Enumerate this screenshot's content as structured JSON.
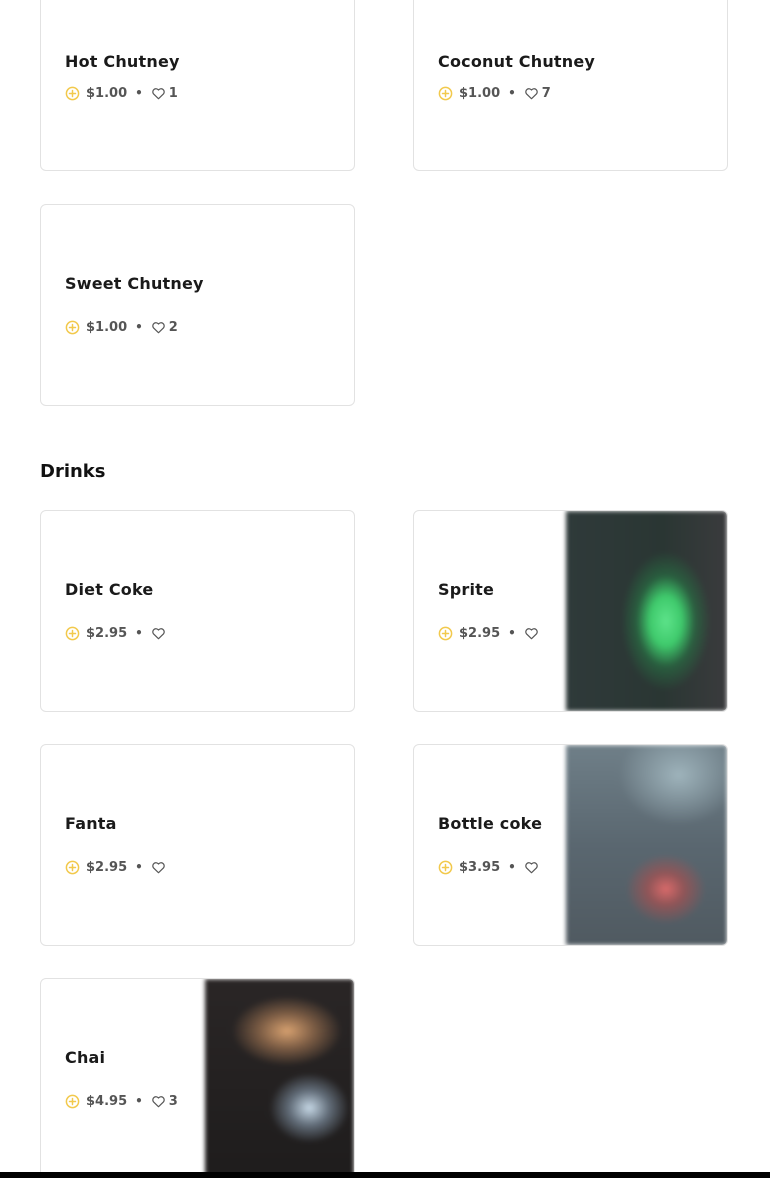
{
  "sections": {
    "drinks_title": "Drinks"
  },
  "items": {
    "hot_chutney": {
      "name": "Hot Chutney",
      "price": "$1.00",
      "likes": "1"
    },
    "coconut_chutney": {
      "name": "Coconut Chutney",
      "price": "$1.00",
      "likes": "7"
    },
    "sweet_chutney": {
      "name": "Sweet Chutney",
      "price": "$1.00",
      "likes": "2"
    },
    "diet_coke": {
      "name": "Diet Coke",
      "price": "$2.95",
      "likes": ""
    },
    "sprite": {
      "name": "Sprite",
      "price": "$2.95",
      "likes": ""
    },
    "fanta": {
      "name": "Fanta",
      "price": "$2.95",
      "likes": ""
    },
    "bottle_coke": {
      "name": "Bottle coke",
      "price": "$3.95",
      "likes": ""
    },
    "chai": {
      "name": "Chai",
      "price": "$4.95",
      "likes": "3"
    }
  },
  "separator": "•",
  "icons": {
    "price": "plus-circle-icon",
    "likes": "heart-outline-icon"
  },
  "colors": {
    "accent_yellow": "#f2c94c",
    "text_dark": "#1a1a1a",
    "text_meta": "#555555",
    "card_border": "#e2e2e2"
  }
}
